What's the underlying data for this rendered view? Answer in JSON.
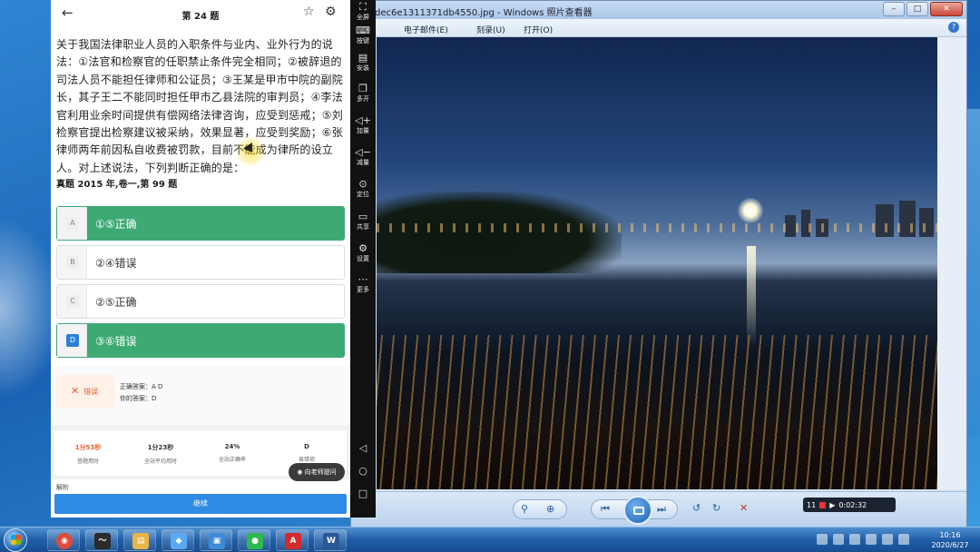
{
  "phone": {
    "title": "第 24 题",
    "question": "关于我国法律职业人员的入职条件与业内、业外行为的说法：①法官和检察官的任职禁止条件完全相同；②被辞退的司法人员不能担任律师和公证员；③王某是甲市中院的副院长，其子王二不能同时担任甲市乙县法院的审判员；④李法官利用业余时间提供有偿网络法律咨询，应受到惩戒；⑤刘检察官提出检察建议被采纳，效果显著，应受到奖励；⑥张律师两年前因私自收费被罚款，目前不能成为律所的设立人。对上述说法，下列判断正确的是：",
    "source": "真题 2015 年,卷一,第 99 题",
    "options": [
      {
        "letter": "A",
        "text": "①⑤正确"
      },
      {
        "letter": "B",
        "text": "②④错误"
      },
      {
        "letter": "C",
        "text": "②⑤正确"
      },
      {
        "letter": "D",
        "text": "③⑥错误"
      }
    ],
    "result": {
      "status_label": "错误",
      "correct_answer": "正确答案：A D",
      "your_answer": "你的答案：D"
    },
    "stats": [
      {
        "value": "1分53秒",
        "label": "答题用时"
      },
      {
        "value": "1分23秒",
        "label": "全站平均用时"
      },
      {
        "value": "24%",
        "label": "全站正确率"
      },
      {
        "value": "D",
        "label": "易错项"
      }
    ],
    "ask_teacher_label": "向老师提问",
    "analysis_label": "解析",
    "continue_label": "继续"
  },
  "side_strip": {
    "items": [
      {
        "glyph": "⛶",
        "label": "全屏"
      },
      {
        "glyph": "⌨",
        "label": "按键"
      },
      {
        "glyph": "▤",
        "label": "安装"
      },
      {
        "glyph": "❐",
        "label": "多开"
      },
      {
        "glyph": "◁+",
        "label": "加量"
      },
      {
        "glyph": "◁−",
        "label": "减量"
      },
      {
        "glyph": "⊙",
        "label": "定位"
      },
      {
        "glyph": "▭",
        "label": "共享"
      },
      {
        "glyph": "⚙",
        "label": "设置"
      },
      {
        "glyph": "⋯",
        "label": "更多"
      }
    ],
    "nav": [
      "◁",
      "○",
      "□"
    ]
  },
  "viewer": {
    "title": "dec6e1311371db4550.jpg - Windows 照片查看器",
    "menus": [
      "电子邮件(E)",
      "刻录(U)",
      "打开(O)"
    ],
    "recording_time": "0:02:32",
    "recording_count": "11"
  },
  "taskbar": {
    "apps": [
      {
        "name": "chrome",
        "color": "#dd4b39",
        "glyph": "◉"
      },
      {
        "name": "app-wave",
        "color": "#2b2b2b",
        "glyph": "〜"
      },
      {
        "name": "file-explorer",
        "color": "#e8b54a",
        "glyph": "▤"
      },
      {
        "name": "app-store",
        "color": "#5aa9f3",
        "glyph": "◆"
      },
      {
        "name": "photo-viewer",
        "color": "#3b8bd8",
        "glyph": "▣"
      },
      {
        "name": "wechat",
        "color": "#2dbb4f",
        "glyph": "●"
      },
      {
        "name": "pdf-reader",
        "color": "#d32b2b",
        "glyph": "A"
      },
      {
        "name": "word",
        "color": "#2b579a",
        "glyph": "W"
      }
    ],
    "time": "10:16",
    "date": "2020/6/27"
  }
}
